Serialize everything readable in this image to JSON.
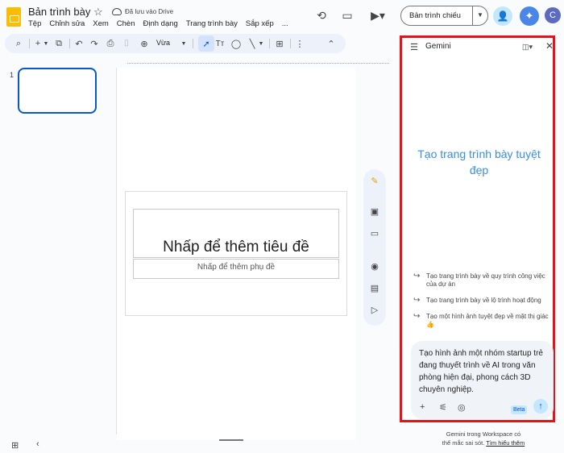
{
  "app": {
    "doc_title": "Bản trình bày",
    "save_status": "Đã lưu vào Drive",
    "menu": [
      "Tệp",
      "Chỉnh sửa",
      "Xem",
      "Chèn",
      "Định dạng",
      "Trang trình bày",
      "Sắp xếp",
      "..."
    ]
  },
  "header": {
    "present_label": "Bản trình chiếu",
    "avatar_letter": "C"
  },
  "toolbar": {
    "zoom_label": "Vừa"
  },
  "filmstrip": {
    "slides": [
      {
        "number": "1"
      }
    ]
  },
  "slide": {
    "title_placeholder": "Nhấp để thêm tiêu đề",
    "subtitle_placeholder": "Nhấp để thêm phụ đề"
  },
  "gemini": {
    "title": "Gemini",
    "headline": "Tạo trang trình bày tuyệt đẹp",
    "suggestions": [
      "Tạo trang trình bày về quy trình công việc của dự án",
      "Tạo trang trình bày về lộ trình hoạt động",
      "Tạo một hình ảnh tuyệt đẹp về mặt thị giác 👍"
    ],
    "prompt_text": "Tạo hình ảnh một nhóm startup trẻ đang thuyết trình về AI trong văn phòng hiện đại, phong cách 3D chuyên nghiệp.",
    "beta_label": "Beta",
    "footer_line1": "Gemini trong Workspace có",
    "footer_line2": "thể mắc sai sót.",
    "footer_link": "Tìm hiểu thêm"
  },
  "colors": {
    "highlight_border": "#e0141b",
    "accent_blue": "#0b57d0",
    "headline_blue": "#3a8ee6"
  }
}
